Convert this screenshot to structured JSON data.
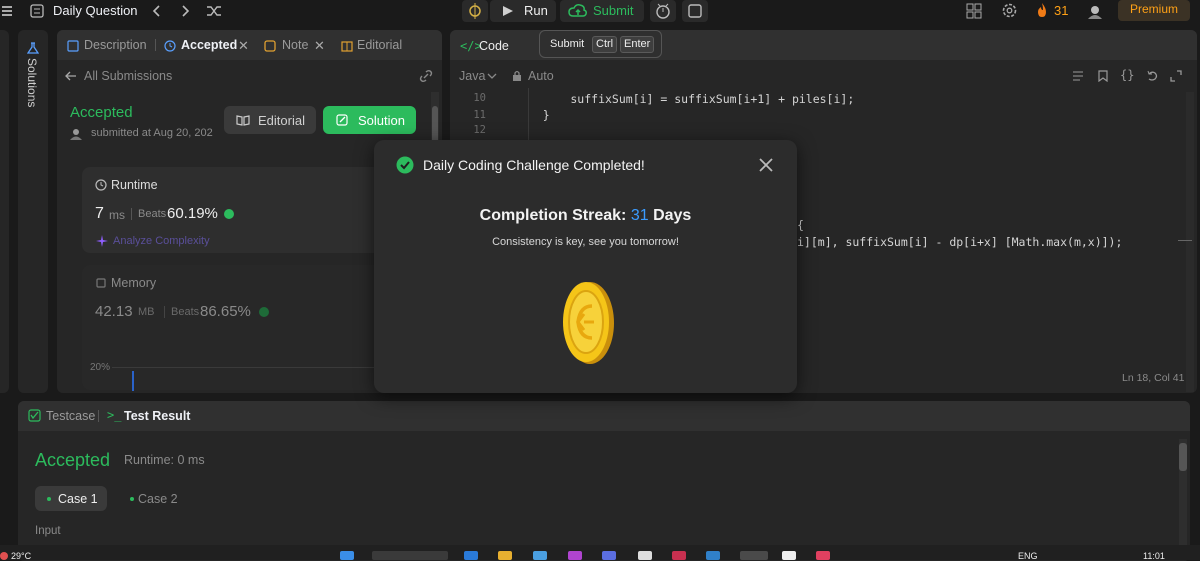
{
  "topbar": {
    "title": "Daily Question",
    "run_label": "Run",
    "submit_label": "Submit",
    "streak_count": "31",
    "premium_label": "Premium"
  },
  "sidebar": {
    "solutions_label": "Solutions"
  },
  "left_panel": {
    "tabs": [
      "Description",
      "Accepted",
      "Note",
      "Editorial"
    ],
    "back_label": "All Submissions",
    "status": "Accepted",
    "submitted_text": "submitted at Aug 20, 202",
    "editorial_button": "Editorial",
    "solution_button": "Solution",
    "runtime": {
      "label": "Runtime",
      "value": "7",
      "unit": "ms",
      "beats_label": "Beats",
      "beats_value": "60.19%",
      "analyze_label": "Analyze Complexity"
    },
    "memory": {
      "label": "Memory",
      "value": "42.13",
      "unit": "MB",
      "beats_label": "Beats",
      "beats_value": "86.65%"
    },
    "chart_tick": "20%"
  },
  "code_panel": {
    "title": "Code",
    "language": "Java",
    "mode": "Auto",
    "lines": [
      {
        "num": "10",
        "text": "        suffixSum[i] = suffixSum[i+1] + piles[i];"
      },
      {
        "num": "11",
        "text": "    }"
      },
      {
        "num": "12",
        "text": ""
      }
    ],
    "fragment1": "{",
    "fragment2": "i][m], suffixSum[i] - dp[i+x] [Math.max(m,x)]);",
    "cursor_status": "Ln 18, Col 41"
  },
  "tooltip": {
    "label": "Submit",
    "key1": "Ctrl",
    "key2": "Enter"
  },
  "modal": {
    "title": "Daily Coding Challenge Completed!",
    "streak_prefix": "Completion Streak:",
    "streak_value": "31",
    "streak_suffix": "Days",
    "message": "Consistency is key, see you tomorrow!"
  },
  "bottom_panel": {
    "tab_testcase": "Testcase",
    "tab_result": "Test Result",
    "status": "Accepted",
    "runtime": "Runtime: 0 ms",
    "cases": [
      "Case 1",
      "Case 2"
    ],
    "input_label": "Input"
  },
  "taskbar": {
    "temperature": "29°C",
    "lang": "ENG",
    "time": "11:01"
  },
  "colors": {
    "accent_green": "#2cbb5d",
    "accent_orange": "#ffa116",
    "streak_blue": "#3b9cff",
    "coin_gold": "#f5c518"
  }
}
